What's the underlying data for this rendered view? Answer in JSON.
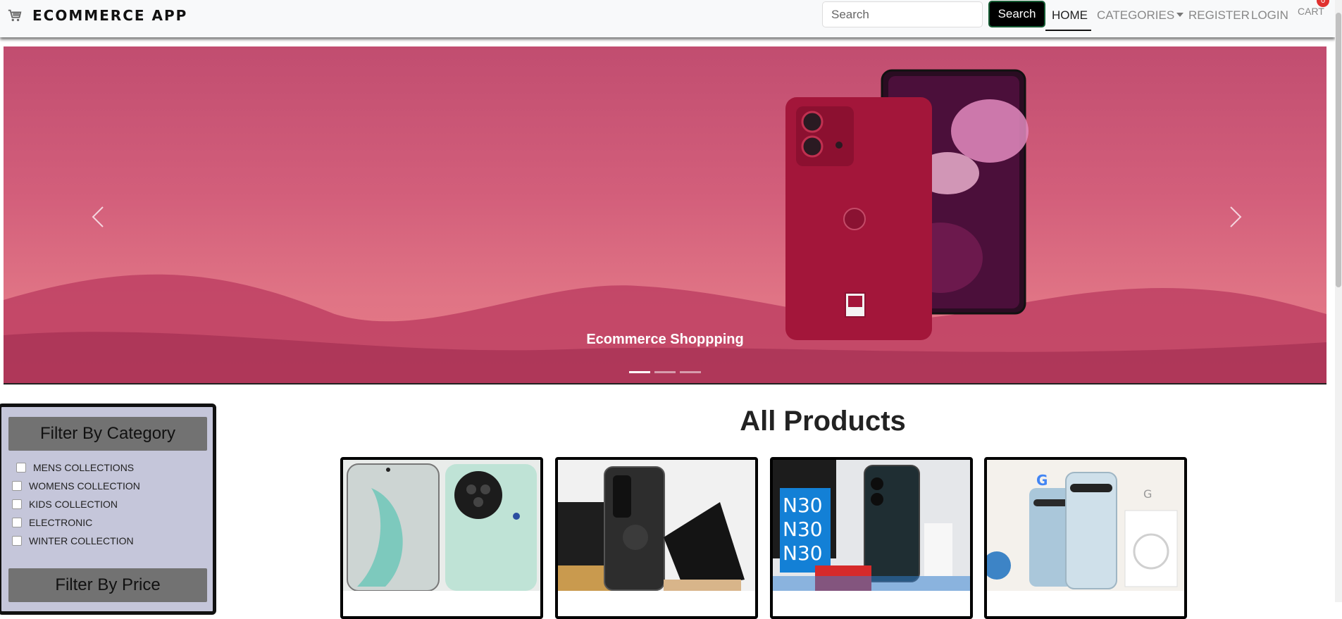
{
  "navbar": {
    "brand": "ECOMMERCE APP",
    "search": {
      "placeholder": "Search",
      "button": "Search"
    },
    "links": {
      "home": "HOME",
      "categories": "CATEGORIES",
      "register": "REGISTER",
      "login": "LOGIN",
      "cart": "CART"
    },
    "cart_count": "0"
  },
  "carousel": {
    "caption": "Ecommerce Shoppping",
    "indicators": 3,
    "active_index": 0
  },
  "filters": {
    "category_title": "Filter By Category",
    "categories": [
      "MENS COLLECTIONS",
      "WOMENS COLLECTION",
      "KIDS COLLECTION",
      "ELECTRONIC",
      "WINTER COLLECTION"
    ],
    "price_title": "Filter By Price"
  },
  "products": {
    "title": "All Products"
  },
  "colors": {
    "accent": "#000000",
    "sidebar_bg": "#c5c6da",
    "filter_header": "#727272",
    "carousel_bg": "#d35f7b",
    "badge": "#e0312f"
  },
  "icons": [
    "cart-icon",
    "chevron-left-icon",
    "chevron-right-icon",
    "caret-down-icon"
  ]
}
